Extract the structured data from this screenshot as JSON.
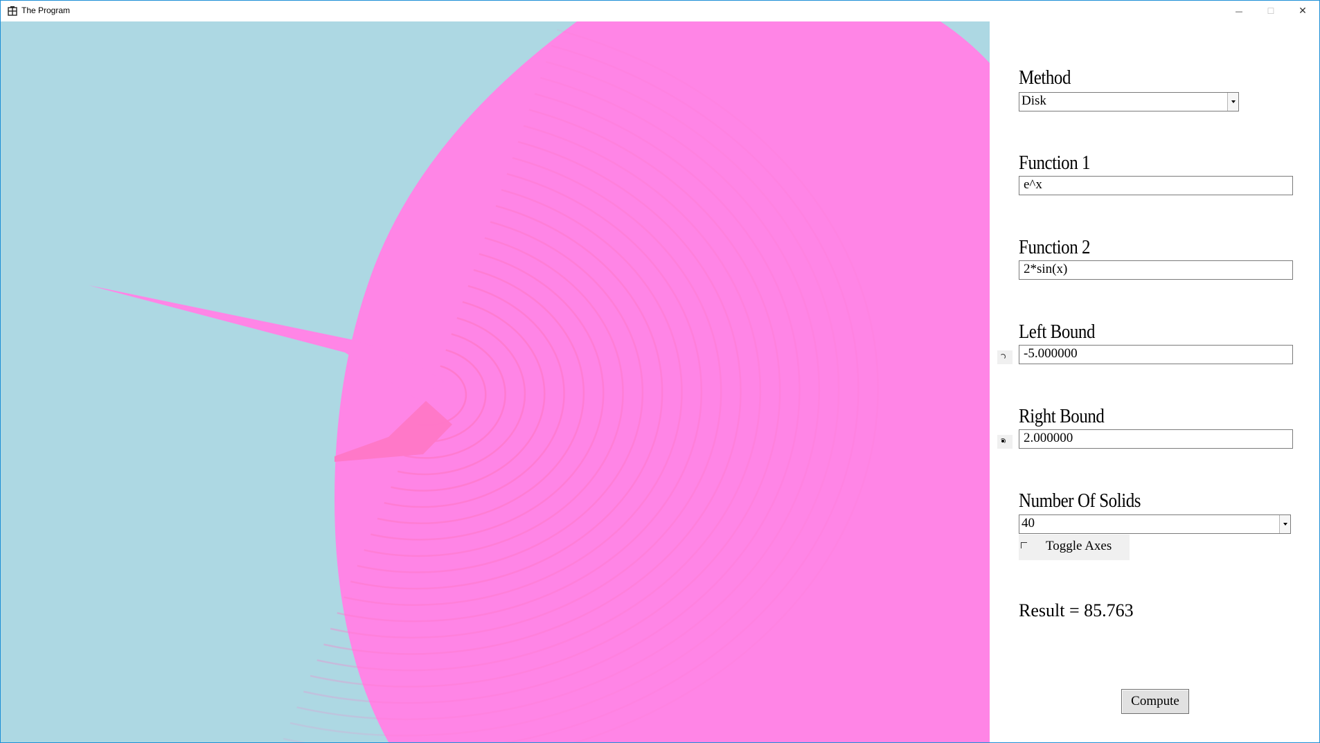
{
  "window": {
    "title": "The Program",
    "controls": {
      "minimize": "—",
      "maximize": "☐",
      "close": "✕"
    }
  },
  "viewport": {
    "background": "#add8e3",
    "solid_color": "#ff85e6",
    "ridge_color": "#ff78c8"
  },
  "panel": {
    "method": {
      "label": "Method",
      "value": "Disk"
    },
    "function1": {
      "label": "Function 1",
      "value": "e^x"
    },
    "function2": {
      "label": "Function 2",
      "value": "2*sin(x)"
    },
    "left_bound": {
      "label": "Left Bound",
      "value": "-5.000000",
      "selected": false
    },
    "right_bound": {
      "label": "Right Bound",
      "value": "2.000000",
      "selected": true
    },
    "solids": {
      "label": "Number Of Solids",
      "value": "40"
    },
    "toggle_axes": {
      "label": "Toggle Axes",
      "checked": false
    },
    "result": "Result = 85.763",
    "compute_label": "Compute"
  }
}
